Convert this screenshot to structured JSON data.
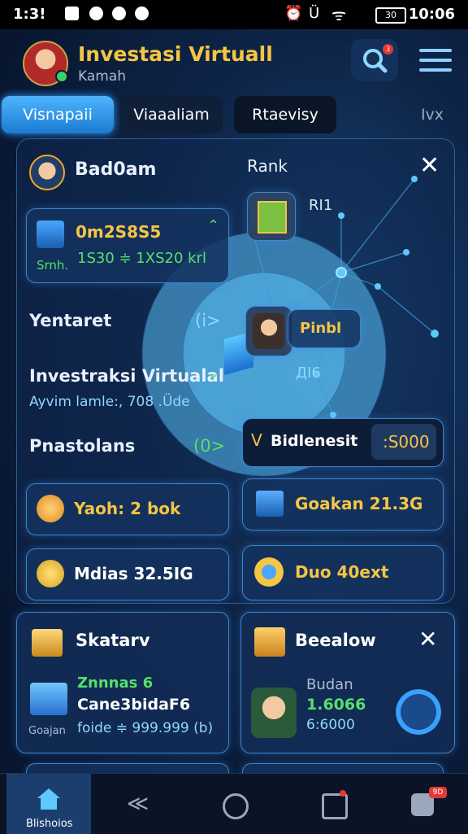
{
  "status_bar": {
    "time": "1:3!",
    "right_time": "10:06",
    "battery": "30"
  },
  "header": {
    "title": "Investasi Virtuall",
    "subtitle": "Kamah",
    "search_badge": "3"
  },
  "tabs": [
    {
      "label": "Visnapaii",
      "active": true
    },
    {
      "label": "Viaaaliam",
      "active": false
    },
    {
      "label": "Rtaevisy",
      "active": false
    },
    {
      "label": "Ivx",
      "active": false
    }
  ],
  "panel": {
    "user_name": "Bad0am",
    "rank_label": "Rank",
    "rank_value": "RI1",
    "stat_card": {
      "value": "0m2S8S5",
      "left": "Srnh.",
      "right": "1S30 ≑ 1XS20 krl"
    },
    "node_label": "Pinbl",
    "node_value": "ДΙ6",
    "row1": {
      "label": "Yentaret",
      "action": "(i>"
    },
    "row2": {
      "title": "Investraksi Virtualal",
      "meta": "Ayvim lamle:, 708 .Üde"
    },
    "row3": {
      "label": "Pnastolans",
      "action": "(0>"
    },
    "bid_card": {
      "label": "Bidlenesit",
      "value": ":S000"
    }
  },
  "grid_cards": [
    {
      "label": "Yaoh: 2 bok"
    },
    {
      "label": "Goakan 21.3G"
    },
    {
      "label": "Mdias 32.5IG"
    },
    {
      "label": "Duo 40ext"
    }
  ],
  "bottom_cards": {
    "left": {
      "title": "Skatarv",
      "line1": "Znnnas 6",
      "line2": "Cane3bidaF6",
      "caption": "Goajan",
      "meta": "foide ≑ 999.999 (b)"
    },
    "right": {
      "title": "Beealow",
      "line1": "Budan",
      "line2": "1.6066",
      "line3": "6:6000"
    }
  },
  "nav": {
    "home_label": "Blishoios",
    "badge": "9D"
  },
  "colors": {
    "accent": "#f5c544",
    "primary": "#2a8ee0",
    "green": "#56e06a"
  }
}
